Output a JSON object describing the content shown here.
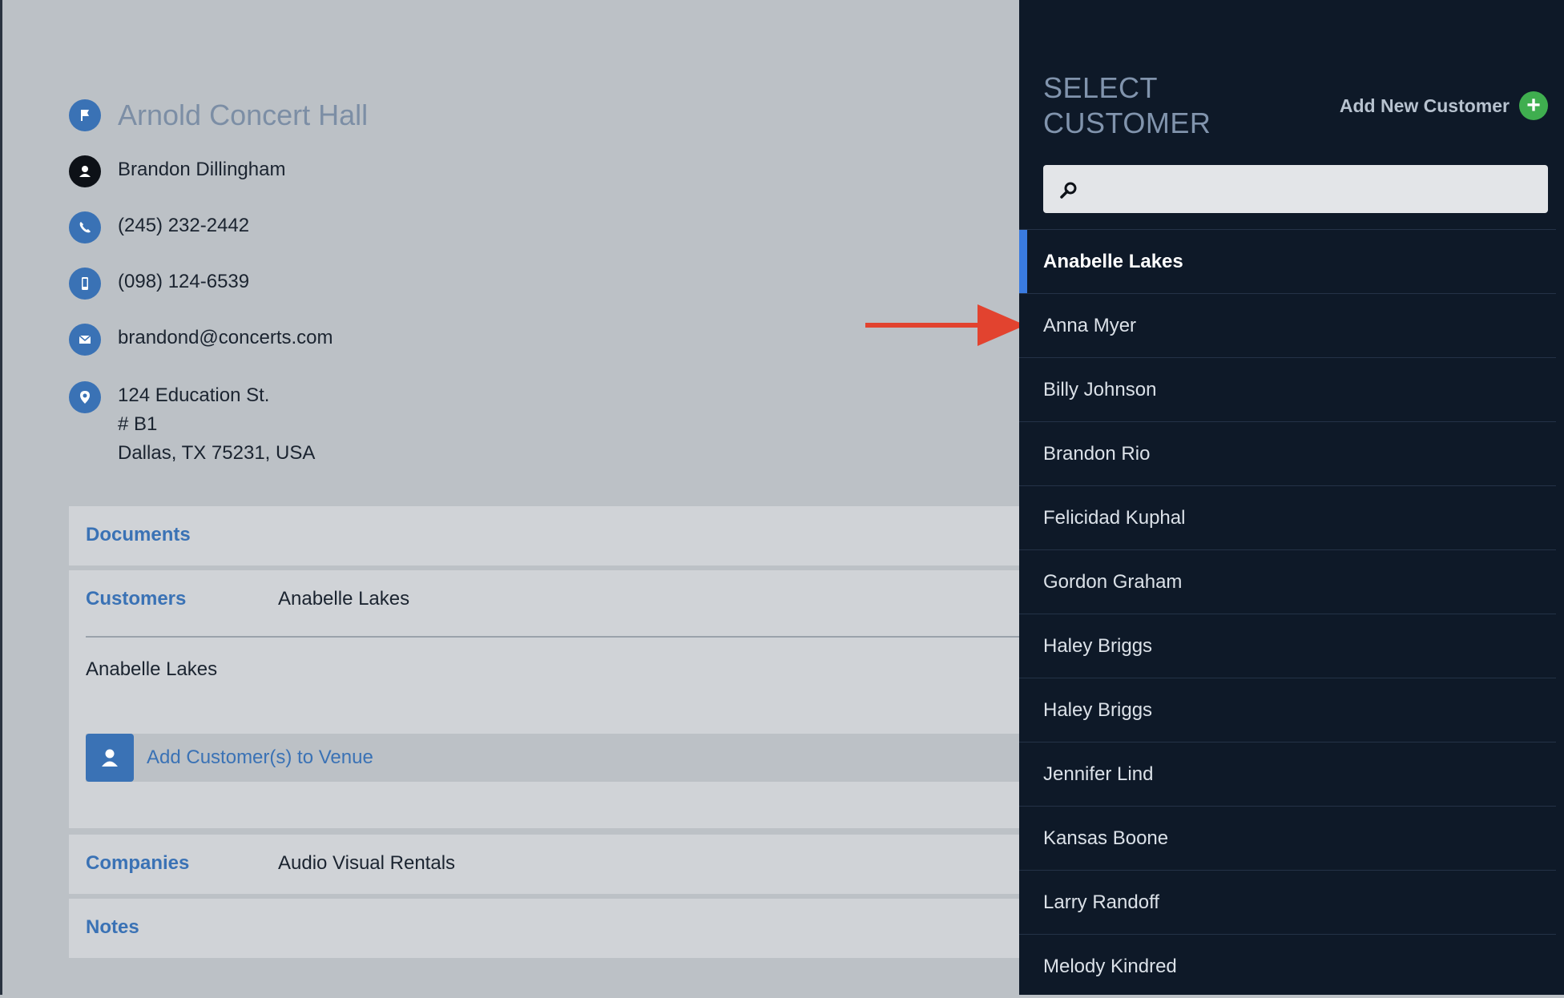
{
  "venue": {
    "name": "Arnold Concert Hall",
    "contact_name": "Brandon Dillingham",
    "phone": "(245) 232-2442",
    "mobile": "(098) 124-6539",
    "email": "brandond@concerts.com",
    "address": [
      "124 Education St.",
      "# B1",
      "Dallas, TX 75231, USA"
    ]
  },
  "sections": {
    "documents": {
      "label": "Documents"
    },
    "customers": {
      "label": "Customers",
      "summary": "Anabelle Lakes",
      "list": [
        "Anabelle Lakes"
      ],
      "add_button_label": "Add Customer(s) to Venue"
    },
    "companies": {
      "label": "Companies",
      "value": "Audio Visual Rentals"
    },
    "notes": {
      "label": "Notes"
    }
  },
  "panel": {
    "title": "SELECT CUSTOMER",
    "add_new_label": "Add New Customer",
    "search_placeholder": "",
    "customers": [
      "Anabelle Lakes",
      "Anna Myer",
      "Billy Johnson",
      "Brandon Rio",
      "Felicidad Kuphal",
      "Gordon Graham",
      "Haley Briggs",
      "Haley Briggs",
      "Jennifer Lind",
      "Kansas Boone",
      "Larry Randoff",
      "Melody Kindred"
    ],
    "selected": "Anabelle Lakes"
  },
  "colors": {
    "accent": "#3a72b5",
    "panel_bg": "#0e1928",
    "add_green": "#3fae4f",
    "annotation_arrow": "#e2432f",
    "selection_bar": "#3a7be0"
  }
}
